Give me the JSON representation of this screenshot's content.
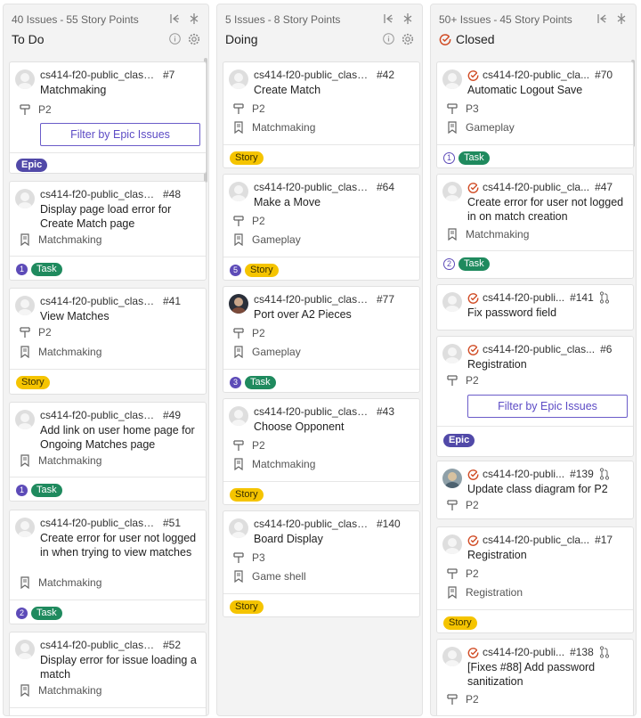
{
  "columns": {
    "todo": {
      "issues": "40 Issues",
      "points": "55 Story Points",
      "name": "To Do",
      "cards": [
        {
          "repo": "cs414-f20-public_class_Te...",
          "num": "#7",
          "title": "Matchmaking",
          "priority": "P2",
          "filter": "Filter by Epic Issues",
          "tag": "Epic"
        },
        {
          "repo": "cs414-f20-public_class_T...",
          "num": "#48",
          "title": "Display page load error for Create Match page",
          "epic": "Matchmaking",
          "count": "1",
          "tag": "Task"
        },
        {
          "repo": "cs414-f20-public_class_T...",
          "num": "#41",
          "title": "View Matches",
          "priority": "P2",
          "epic": "Matchmaking",
          "tag": "Story"
        },
        {
          "repo": "cs414-f20-public_class_T...",
          "num": "#49",
          "title": "Add link on user home page for Ongoing Matches page",
          "epic": "Matchmaking",
          "count": "1",
          "tag": "Task"
        },
        {
          "repo": "cs414-f20-public_class_T...",
          "num": "#51",
          "title": "Create error for user not logged in when trying to view matches",
          "epic": "Matchmaking",
          "count": "2",
          "tag": "Task"
        },
        {
          "repo": "cs414-f20-public_class_T...",
          "num": "#52",
          "title": "Display error for issue loading a match",
          "epic": "Matchmaking"
        }
      ]
    },
    "doing": {
      "issues": "5 Issues",
      "points": "8 Story Points",
      "name": "Doing",
      "cards": [
        {
          "repo": "cs414-f20-public_class_T...",
          "num": "#42",
          "title": "Create Match",
          "priority": "P2",
          "epic": "Matchmaking",
          "tag": "Story"
        },
        {
          "repo": "cs414-f20-public_class_T...",
          "num": "#64",
          "title": "Make a Move",
          "priority": "P2",
          "epic": "Gameplay",
          "count": "5",
          "tag": "Story"
        },
        {
          "repo": "cs414-f20-public_class_T...",
          "num": "#77",
          "title": "Port over A2 Pieces",
          "priority": "P2",
          "epic": "Gameplay",
          "count": "3",
          "tag": "Task"
        },
        {
          "repo": "cs414-f20-public_class_T...",
          "num": "#43",
          "title": "Choose Opponent",
          "priority": "P2",
          "epic": "Matchmaking",
          "tag": "Story"
        },
        {
          "repo": "cs414-f20-public_class_...",
          "num": "#140",
          "title": "Board Display",
          "priority": "P3",
          "epic": "Game shell",
          "tag": "Story"
        }
      ]
    },
    "closed": {
      "issues": "50+ Issues",
      "points": "45 Story Points",
      "name": "Closed",
      "cards": [
        {
          "repo": "cs414-f20-public_cla...",
          "num": "#70",
          "title": "Automatic Logout Save",
          "priority": "P3",
          "epic": "Gameplay",
          "count": "1",
          "tag": "Task"
        },
        {
          "repo": "cs414-f20-public_cla...",
          "num": "#47",
          "title": "Create error for user not logged in on match creation",
          "epic": "Matchmaking",
          "count": "2",
          "tag": "Task"
        },
        {
          "repo": "cs414-f20-publi...",
          "num": "#141",
          "title": "Fix password field"
        },
        {
          "repo": "cs414-f20-public_clas...",
          "num": "#6",
          "title": "Registration",
          "priority": "P2",
          "filter": "Filter by Epic Issues",
          "tag": "Epic"
        },
        {
          "repo": "cs414-f20-publi...",
          "num": "#139",
          "title": "Update class diagram for P2",
          "priority": "P2"
        },
        {
          "repo": "cs414-f20-public_cla...",
          "num": "#17",
          "title": "Registration",
          "priority": "P2",
          "epic": "Registration",
          "tag": "Story"
        },
        {
          "repo": "cs414-f20-publi...",
          "num": "#138",
          "title": "[Fixes #88] Add password sanitization",
          "priority": "P2"
        }
      ]
    }
  },
  "sep": "-",
  "colors": {
    "epic": "#5149a8",
    "task": "#1f8a5e",
    "story": "#f5c400",
    "closed": "#d04b24"
  },
  "icons": [
    "collapse-icon",
    "minimize-icon",
    "info-icon",
    "gear-icon",
    "priority-icon",
    "epic-icon",
    "closed-issue-icon",
    "pull-request-icon",
    "avatar"
  ]
}
